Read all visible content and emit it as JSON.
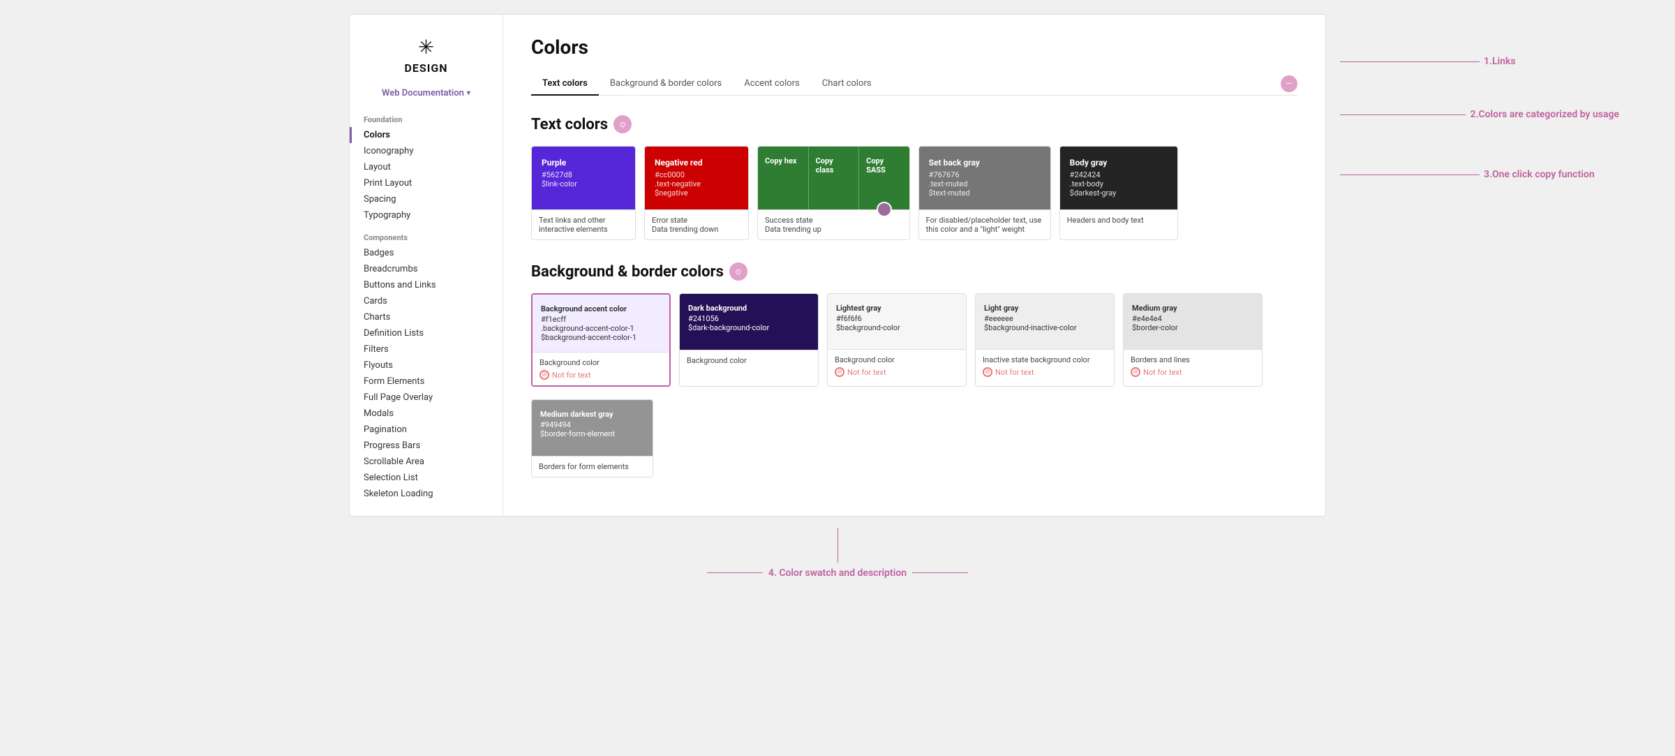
{
  "sidebar": {
    "logo_icon": "✳",
    "logo_text": "DESIGN",
    "dropdown_label": "Web Documentation",
    "foundation_label": "Foundation",
    "items_foundation": [
      {
        "label": "Colors",
        "active": true
      },
      {
        "label": "Iconography",
        "active": false
      },
      {
        "label": "Layout",
        "active": false
      },
      {
        "label": "Print Layout",
        "active": false
      },
      {
        "label": "Spacing",
        "active": false
      },
      {
        "label": "Typography",
        "active": false
      }
    ],
    "components_label": "Components",
    "items_components": [
      {
        "label": "Badges",
        "active": false
      },
      {
        "label": "Breadcrumbs",
        "active": false
      },
      {
        "label": "Buttons and Links",
        "active": false
      },
      {
        "label": "Cards",
        "active": false
      },
      {
        "label": "Charts",
        "active": false
      },
      {
        "label": "Definition Lists",
        "active": false
      },
      {
        "label": "Filters",
        "active": false
      },
      {
        "label": "Flyouts",
        "active": false
      },
      {
        "label": "Form Elements",
        "active": false
      },
      {
        "label": "Full Page Overlay",
        "active": false
      },
      {
        "label": "Modals",
        "active": false
      },
      {
        "label": "Pagination",
        "active": false
      },
      {
        "label": "Progress Bars",
        "active": false
      },
      {
        "label": "Scrollable Area",
        "active": false
      },
      {
        "label": "Selection List",
        "active": false
      },
      {
        "label": "Skeleton Loading",
        "active": false
      }
    ]
  },
  "page": {
    "title": "Colors",
    "tabs": [
      {
        "label": "Text colors",
        "active": true
      },
      {
        "label": "Background & border colors",
        "active": false
      },
      {
        "label": "Accent colors",
        "active": false
      },
      {
        "label": "Chart colors",
        "active": false
      }
    ]
  },
  "text_colors_section": {
    "title": "Text colors",
    "swatches": [
      {
        "type": "single",
        "bg": "#5627d8",
        "text_color": "#fff",
        "name": "Purple",
        "values": [
          "#5627d8",
          "$link-color"
        ],
        "description": "Text links and other interactive elements"
      },
      {
        "type": "single",
        "bg": "#cc0000",
        "text_color": "#fff",
        "name": "Negative red",
        "values": [
          "#cc0000",
          ".text-negative",
          "$negative"
        ],
        "description": "Error state\nData trending down"
      },
      {
        "type": "split",
        "bg": "#2e7d32",
        "text_color": "#fff",
        "parts": [
          {
            "label": "Copy hex"
          },
          {
            "label": "Copy class"
          },
          {
            "label": "Copy SASS"
          }
        ],
        "description": "Success state\nData trending up"
      },
      {
        "type": "single",
        "bg": "#767676",
        "text_color": "#fff",
        "name": "Set back gray",
        "values": [
          "#767676",
          ".text-muted",
          "$text-muted"
        ],
        "description": "For disabled/placeholder text, use this color and a \"light\" weight"
      },
      {
        "type": "single",
        "bg": "#242424",
        "text_color": "#fff",
        "name": "Body gray",
        "values": [
          "#242424",
          ".text-body",
          "$darkest-gray"
        ],
        "description": "Headers and body text"
      }
    ]
  },
  "bg_colors_section": {
    "title": "Background & border colors",
    "swatches": [
      {
        "bg": "#f1ecff",
        "text_color": "#333",
        "name": "Background accent color",
        "values": [
          "#f1ecff",
          ".background-accent-color-1",
          "$background-accent-color-1"
        ],
        "description": "Background color",
        "not_for_text": true,
        "highlighted": true
      },
      {
        "bg": "#241056",
        "text_color": "#fff",
        "name": "Dark background",
        "values": [
          "#241056",
          "$dark-background-color"
        ],
        "description": "Background color",
        "not_for_text": false,
        "highlighted": false
      },
      {
        "bg": "#f6f6f6",
        "text_color": "#333",
        "name": "Lightest gray",
        "values": [
          "#f6f6f6",
          "$background-color"
        ],
        "description": "Background color",
        "not_for_text": true,
        "highlighted": false
      },
      {
        "bg": "#eeeeee",
        "text_color": "#333",
        "name": "Light gray",
        "values": [
          "#eeeeee",
          "$background-inactive-color"
        ],
        "description": "Inactive state background color",
        "not_for_text": true,
        "highlighted": false
      },
      {
        "bg": "#e4e4e4",
        "text_color": "#333",
        "name": "Medium gray",
        "values": [
          "#e4e4e4",
          "$border-color"
        ],
        "description": "Borders and lines",
        "not_for_text": true,
        "highlighted": false
      }
    ],
    "swatches2": [
      {
        "bg": "#949494",
        "text_color": "#fff",
        "name": "Medium darkest gray",
        "values": [
          "#949494",
          "$border-form-element"
        ],
        "description": "Borders for form elements",
        "highlighted": false
      }
    ]
  },
  "annotations": {
    "links": "1.Links",
    "colors_categorized": "2.Colors are categorized by usage",
    "copy_function": "3.One click copy function",
    "swatch_desc": "4. Color swatch and description"
  }
}
